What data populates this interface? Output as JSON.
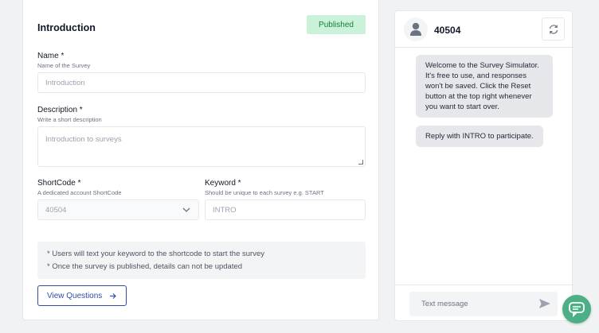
{
  "form": {
    "title": "Introduction",
    "status_badge": "Published",
    "name": {
      "label": "Name *",
      "help": "Name of the Survey",
      "value": "Introduction"
    },
    "description": {
      "label": "Description *",
      "help": "Write a short description",
      "value": "Introduction to surveys"
    },
    "shortcode": {
      "label": "ShortCode *",
      "help": "A dedicated account ShortCode",
      "value": "40504"
    },
    "keyword": {
      "label": "Keyword *",
      "help": "Should be unique to each survey e.g. START",
      "value": "INTRO"
    },
    "notes": [
      "* Users will text your keyword to the shortcode to start the survey",
      "* Once the survey is published, details can not be updated"
    ],
    "view_questions_label": "View Questions"
  },
  "simulator": {
    "title": "40504",
    "messages": [
      "Welcome to the Survey Simulator. It's free to use, and responses won't be saved. Click the Reset button at the top right whenever you want to start over.",
      "Reply with INTRO to participate."
    ],
    "input_placeholder": "Text message"
  },
  "icons": {
    "avatar": "user-icon",
    "reset": "refresh-icon",
    "dropdown": "chevron-down-icon",
    "arrow": "arrow-right-icon",
    "send": "send-icon",
    "chat": "chat-bubble-icon"
  },
  "colors": {
    "badge_bg": "#c9f2d9",
    "badge_text": "#15803d",
    "button_border": "#2f4fa8",
    "fab": "#4caf85"
  }
}
